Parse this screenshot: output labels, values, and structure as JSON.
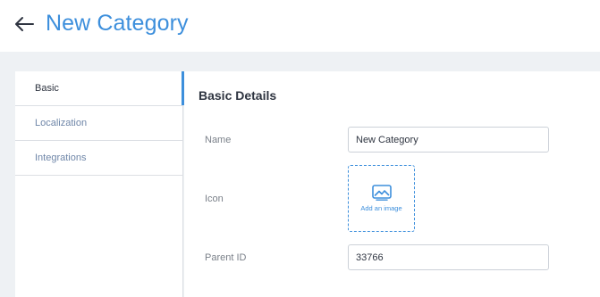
{
  "header": {
    "back_icon": "arrow-left-icon",
    "title": "New Category"
  },
  "sidebar": {
    "items": [
      {
        "label": "Basic",
        "active": true
      },
      {
        "label": "Localization",
        "active": false
      },
      {
        "label": "Integrations",
        "active": false
      }
    ]
  },
  "main": {
    "section_title": "Basic Details",
    "fields": {
      "name": {
        "label": "Name",
        "value": "New Category"
      },
      "icon": {
        "label": "Icon",
        "upload_label": "Add an image",
        "upload_icon": "image-icon"
      },
      "parent_id": {
        "label": "Parent ID",
        "value": "33766"
      }
    }
  },
  "colors": {
    "accent": "#3d8fdc",
    "background": "#eef1f4",
    "text_dark": "#2e3440",
    "text_muted": "#7a8089",
    "nav_link": "#6f86a8"
  }
}
